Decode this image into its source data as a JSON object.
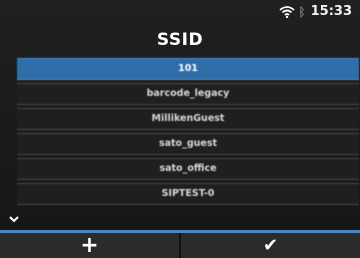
{
  "status": {
    "time": "15:33",
    "wifi_icon": "wifi-icon",
    "bluetooth_icon": "bluetooth-icon"
  },
  "title": "SSID",
  "ssid_list": [
    {
      "label": "101",
      "selected": true
    },
    {
      "label": "barcode_legacy"
    },
    {
      "label": "MillikenGuest"
    },
    {
      "label": "sato_guest"
    },
    {
      "label": "sato_office"
    },
    {
      "label": "SIPTEST-0"
    }
  ],
  "buttons": {
    "add": "+",
    "confirm": "✔"
  },
  "colors": {
    "accent": "#3b8ad9",
    "selected": "#2f6ea8"
  }
}
